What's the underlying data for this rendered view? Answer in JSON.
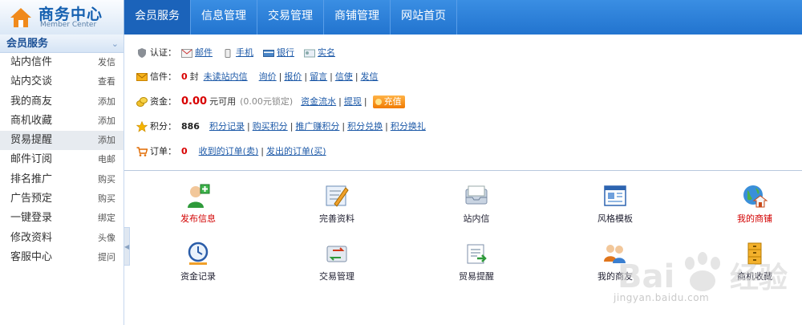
{
  "header": {
    "logo_title": "商务中心",
    "logo_subtitle": "Member Center",
    "nav": [
      {
        "label": "会员服务",
        "active": true
      },
      {
        "label": "信息管理"
      },
      {
        "label": "交易管理"
      },
      {
        "label": "商铺管理"
      },
      {
        "label": "网站首页"
      }
    ]
  },
  "sidebar": {
    "section_title": "会员服务",
    "items": [
      {
        "label": "站内信件",
        "action": "发信"
      },
      {
        "label": "站内交谈",
        "action": "查看"
      },
      {
        "label": "我的商友",
        "action": "添加"
      },
      {
        "label": "商机收藏",
        "action": "添加"
      },
      {
        "label": "贸易提醒",
        "action": "添加",
        "highlighted": true
      },
      {
        "label": "邮件订阅",
        "action": "电邮"
      },
      {
        "label": "排名推广",
        "action": "购买"
      },
      {
        "label": "广告预定",
        "action": "购买"
      },
      {
        "label": "一键登录",
        "action": "绑定"
      },
      {
        "label": "修改资料",
        "action": "头像"
      },
      {
        "label": "客服中心",
        "action": "提问"
      }
    ]
  },
  "info": {
    "auth": {
      "label": "认证：",
      "links": [
        "邮件",
        "手机",
        "银行",
        "实名"
      ]
    },
    "mail": {
      "label": "信件：",
      "count": "0",
      "unit": "封",
      "unread": "未读站内信",
      "links": [
        "询价",
        "报价",
        "留言",
        "信使",
        "发信"
      ]
    },
    "funds": {
      "label": "资金：",
      "amount": "0.00",
      "available": "元可用",
      "locked": "(0.00元锁定)",
      "links": [
        "资金流水",
        "提现"
      ],
      "charge": "充值"
    },
    "points": {
      "label": "积分：",
      "value": "886",
      "links": [
        "积分记录",
        "购买积分",
        "推广赚积分",
        "积分兑换",
        "积分换礼"
      ]
    },
    "orders": {
      "label": "订单：",
      "count": "0",
      "links": [
        "收到的订单(卖)",
        "发出的订单(买)"
      ]
    }
  },
  "grid": [
    {
      "label": "发布信息",
      "icon": "publish-icon",
      "red": true
    },
    {
      "label": "完善资料",
      "icon": "edit-profile-icon"
    },
    {
      "label": "站内信",
      "icon": "inbox-icon"
    },
    {
      "label": "风格模板",
      "icon": "template-icon"
    },
    {
      "label": "我的商铺",
      "icon": "shop-globe-icon",
      "red": true
    },
    {
      "label": "资金记录",
      "icon": "clock-icon"
    },
    {
      "label": "交易管理",
      "icon": "trade-icon"
    },
    {
      "label": "贸易提醒",
      "icon": "reminder-icon"
    },
    {
      "label": "我的商友",
      "icon": "friends-icon"
    },
    {
      "label": "商机收藏",
      "icon": "cabinet-icon"
    }
  ],
  "watermark": {
    "url_text": "jingyan.baidu.com"
  },
  "colors": {
    "nav_bg": "#2274cf",
    "accent_red": "#d80000",
    "link": "#1e5aa8",
    "charge": "#f07a00"
  }
}
